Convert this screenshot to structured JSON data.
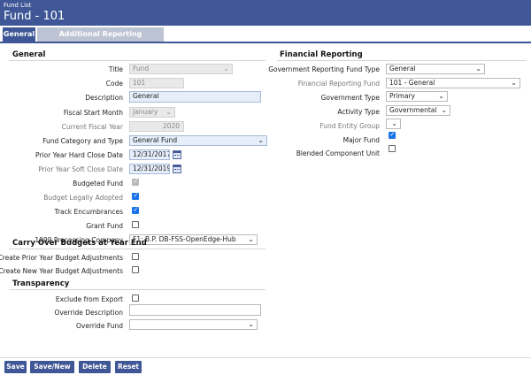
{
  "header": {
    "breadcrumb": "Fund List",
    "title": "Fund - 101"
  },
  "tabs": [
    {
      "label": "General",
      "active": true
    },
    {
      "label": "Additional Reporting Companies",
      "active": false
    }
  ],
  "general": {
    "heading": "General",
    "title_label": "Title",
    "title_value": "Fund",
    "code_label": "Code",
    "code_value": "101",
    "description_label": "Description",
    "description_value": "General",
    "fiscal_start_month_label": "Fiscal Start Month",
    "fiscal_start_month_value": "January",
    "current_fiscal_year_label": "Current Fiscal Year",
    "current_fiscal_year_value": "2020",
    "fund_category_label": "Fund Category and Type",
    "fund_category_value": "General Fund",
    "hard_close_label": "Prior Year Hard Close Date",
    "hard_close_value": "12/31/2017",
    "soft_close_label": "Prior Year Soft Close Date",
    "soft_close_value": "12/31/2019",
    "budgeted_fund_label": "Budgeted Fund",
    "budget_legally_adopted_label": "Budget Legally Adopted",
    "track_encumbrances_label": "Track Encumbrances",
    "grant_fund_label": "Grant Fund",
    "processing_company_label": "1099 Processing Company",
    "processing_company_value": "F1: B.P. DB-FSS-OpenEdge-Hub"
  },
  "carry_over": {
    "heading": "Carry Over Budgets at Year End",
    "prior_year_label": "Create Prior Year Budget Adjustments",
    "new_year_label": "Create New Year Budget Adjustments"
  },
  "transparency": {
    "heading": "Transparency",
    "exclude_label": "Exclude from Export",
    "override_description_label": "Override Description",
    "override_description_value": "",
    "override_fund_label": "Override Fund",
    "override_fund_value": ""
  },
  "financial_reporting": {
    "heading": "Financial Reporting",
    "gov_fund_type_label": "Government Reporting Fund Type",
    "gov_fund_type_value": "General",
    "fin_reporting_fund_label": "Financial Reporting Fund",
    "fin_reporting_fund_value": "101 - General",
    "gov_type_label": "Government Type",
    "gov_type_value": "Primary",
    "activity_type_label": "Activity Type",
    "activity_type_value": "Governmental",
    "fund_entity_group_label": "Fund Entity Group",
    "fund_entity_group_value": "",
    "major_fund_label": "Major Fund",
    "blended_label": "Blended Component Unit"
  },
  "checkboxes": {
    "budgeted_fund": true,
    "budget_legally_adopted": true,
    "track_encumbrances": true,
    "grant_fund": false,
    "prior_year_adjust": false,
    "new_year_adjust": false,
    "exclude_export": false,
    "major_fund": true,
    "blended": false
  },
  "footer": {
    "save": "Save",
    "save_new": "Save/New",
    "delete": "Delete",
    "reset": "Reset"
  },
  "colors": {
    "accent": "#3f5796",
    "checkbox": "#1a73e8"
  }
}
